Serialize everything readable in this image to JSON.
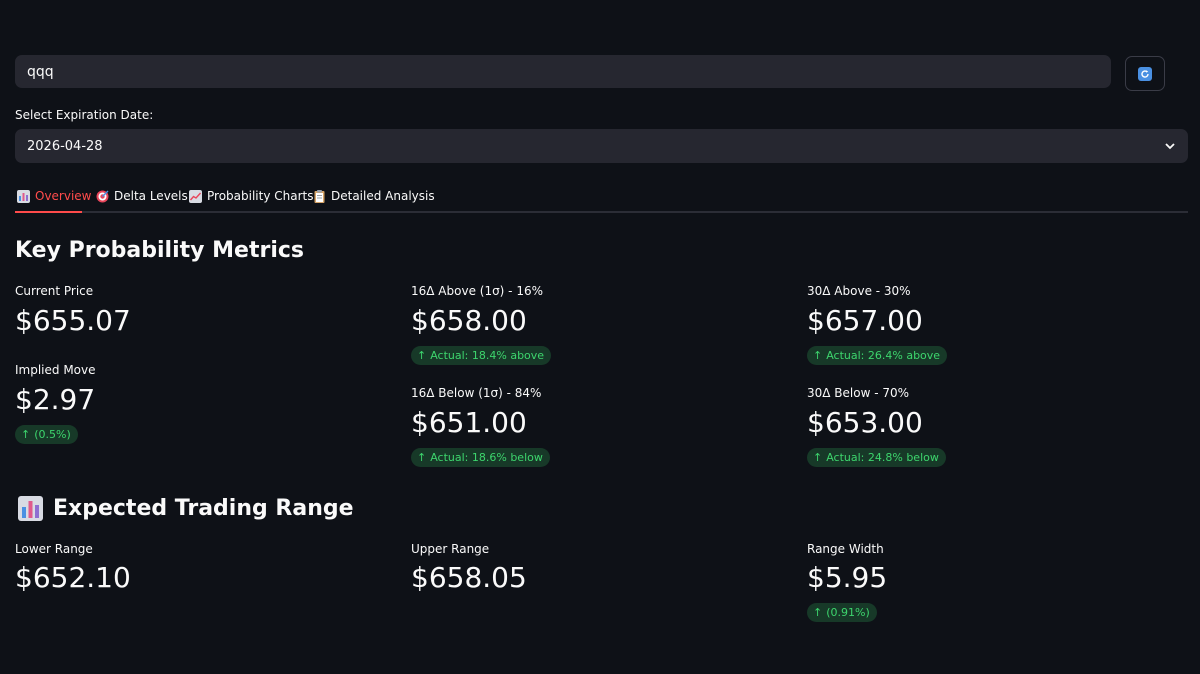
{
  "search": {
    "value": "qqq"
  },
  "expiration": {
    "label": "Select Expiration Date:",
    "selected": "2026-04-28"
  },
  "tabs": [
    {
      "label": "Overview",
      "icon": "bar-chart-icon"
    },
    {
      "label": "Delta Levels",
      "icon": "target-icon"
    },
    {
      "label": "Probability Charts",
      "icon": "line-chart-icon"
    },
    {
      "label": "Detailed Analysis",
      "icon": "clipboard-icon"
    }
  ],
  "key_metrics": {
    "title": "Key Probability Metrics",
    "current_price": {
      "label": "Current Price",
      "value": "$655.07"
    },
    "implied_move": {
      "label": "Implied Move",
      "value": "$2.97",
      "delta": "(0.5%)"
    },
    "d16_above": {
      "label": "16Δ Above (1σ) - 16%",
      "value": "$658.00",
      "delta": "Actual: 18.4% above"
    },
    "d16_below": {
      "label": "16Δ Below (1σ) - 84%",
      "value": "$651.00",
      "delta": "Actual: 18.6% below"
    },
    "d30_above": {
      "label": "30Δ Above - 30%",
      "value": "$657.00",
      "delta": "Actual: 26.4% above"
    },
    "d30_below": {
      "label": "30Δ Below - 70%",
      "value": "$653.00",
      "delta": "Actual: 24.8% below"
    }
  },
  "trading_range": {
    "title": "Expected Trading Range",
    "icon": "bar-chart-icon",
    "lower": {
      "label": "Lower Range",
      "value": "$652.10"
    },
    "upper": {
      "label": "Upper Range",
      "value": "$658.05"
    },
    "width": {
      "label": "Range Width",
      "value": "$5.95",
      "delta": "(0.91%)"
    }
  },
  "colors": {
    "accent": "#ff4b4b",
    "positive": "#3dd56d",
    "positive_bg": "#173928",
    "background": "#0e1117",
    "input_bg": "#262730"
  }
}
